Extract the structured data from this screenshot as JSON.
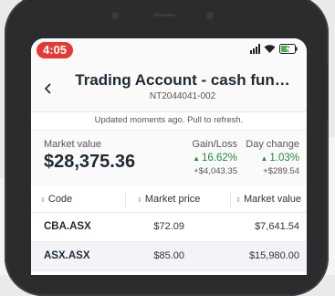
{
  "status_bar": {
    "time": "4:05"
  },
  "header": {
    "title": "Trading Account - cash fun…",
    "account_number": "NT2044041-002"
  },
  "refresh_note": "Updated moments ago. Pull to refresh.",
  "summary": {
    "market_value_label": "Market value",
    "market_value": "$28,375.36",
    "gain_loss_label": "Gain/Loss",
    "gain_loss_pct": "16.62%",
    "gain_loss_abs": "+$4,043.35",
    "day_change_label": "Day change",
    "day_change_pct": "1.03%",
    "day_change_abs": "+$289.54",
    "positive_color": "#1e8e3e"
  },
  "table": {
    "headers": {
      "code": "Code",
      "price": "Market price",
      "value": "Market value"
    },
    "rows": [
      {
        "code": "CBA.ASX",
        "price": "$72.09",
        "value": "$7,641.54"
      },
      {
        "code": "ASX.ASX",
        "price": "$85.00",
        "value": "$15,980.00"
      }
    ]
  },
  "colors": {
    "accent_red": "#e53935",
    "text_dark": "#1f2a33"
  }
}
